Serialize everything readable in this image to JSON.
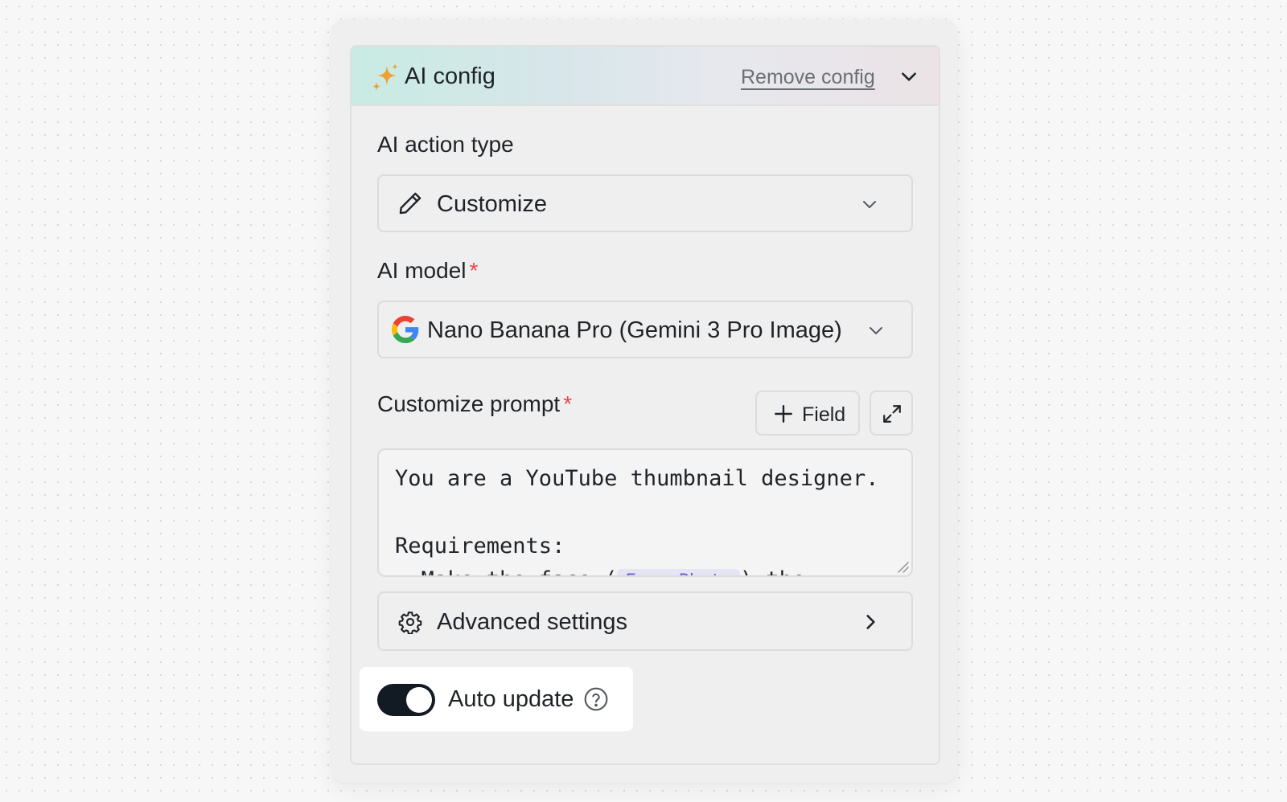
{
  "header": {
    "title": "AI config",
    "remove_label": "Remove config",
    "sparkle_icon": "sparkle-icon",
    "collapse_icon": "chevron-down-icon"
  },
  "action_type": {
    "label": "AI action type",
    "value": "Customize",
    "icon": "pencil-icon"
  },
  "model": {
    "label": "AI model",
    "required_mark": "*",
    "value": "Nano Banana Pro (Gemini 3 Pro Image)",
    "icon": "google-icon"
  },
  "prompt": {
    "label": "Customize prompt",
    "required_mark": "*",
    "add_field_label": "Field",
    "lines": [
      "You are a YouTube thumbnail designer.",
      "",
      "Requirements:"
    ],
    "partial_line_prefix": "- Make the face (",
    "partial_chip": "Face Photo",
    "partial_line_suffix": ") the"
  },
  "advanced": {
    "label": "Advanced settings",
    "icon": "gear-icon"
  },
  "auto_update": {
    "label": "Auto update",
    "enabled": true,
    "help_icon": "question-circle-icon"
  },
  "colors": {
    "accent_dark": "#121a24",
    "required": "#e5484d",
    "chip_text": "#6b5bd1",
    "sparkle": "#f0a030"
  }
}
